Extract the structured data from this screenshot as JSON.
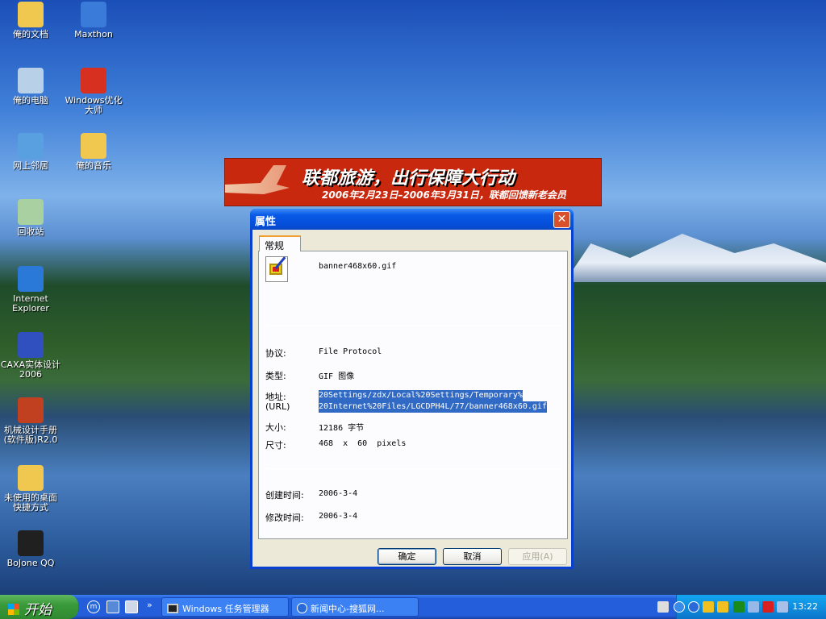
{
  "desktop": {
    "icons": [
      {
        "label": "俺的文档",
        "icon": "folder-icon",
        "color": "#f0c850"
      },
      {
        "label": "Maxthon",
        "icon": "maxthon-icon",
        "color": "#3a7ad8"
      },
      {
        "label": "俺的电脑",
        "icon": "computer-icon",
        "color": "#b8d0e8"
      },
      {
        "label": "Windows优化大师",
        "icon": "optimizer-icon",
        "color": "#d83020"
      },
      {
        "label": "网上邻居",
        "icon": "network-icon",
        "color": "#58a0e0"
      },
      {
        "label": "俺的音乐",
        "icon": "music-folder-icon",
        "color": "#f0c850"
      },
      {
        "label": "回收站",
        "icon": "recycle-bin-icon",
        "color": "#a8d0a0"
      },
      {
        "label": "Internet Explorer",
        "icon": "ie-icon",
        "color": "#2a78d8"
      },
      {
        "label": "CAXA实体设计2006",
        "icon": "caxa-icon",
        "color": "#3050c0"
      },
      {
        "label": "机械设计手册(软件版)R2.0",
        "icon": "books-icon",
        "color": "#c04020"
      },
      {
        "label": "未使用的桌面快捷方式",
        "icon": "folder-icon",
        "color": "#f0c850"
      },
      {
        "label": "BoJone QQ",
        "icon": "qq-icon",
        "color": "#202020"
      }
    ]
  },
  "banner": {
    "headline": "联都旅游，出行保障大行动",
    "subline": "2006年2月23日–2006年3月31日，联都回馈新老会员"
  },
  "dialog": {
    "title": "属性",
    "close": "✕",
    "tab": "常规",
    "filename": "banner468x60.gif",
    "protocol_label": "协议:",
    "protocol": "File Protocol",
    "type_label": "类型:",
    "type": "GIF 图像",
    "address_label": "地址:",
    "address_label2": "(URL)",
    "address_line1": "20Settings/zdx/Local%20Settings/Temporary%",
    "address_line2": "20Internet%20Files/LGCDPH4L/77/banner468x60.gif",
    "size_label": "大小:",
    "size": "12186 字节",
    "dims_label": "尺寸:",
    "dims": "468  x  60  pixels",
    "created_label": "创建时间:",
    "created": "2006-3-4",
    "modified_label": "修改时间:",
    "modified": "2006-3-4",
    "ok": "确定",
    "cancel": "取消",
    "apply": "应用(A)"
  },
  "taskbar": {
    "start": "开始",
    "more": "»",
    "tasks": [
      "Windows 任务管理器",
      "新闻中心-搜狐网..."
    ],
    "clock": "13:22"
  }
}
